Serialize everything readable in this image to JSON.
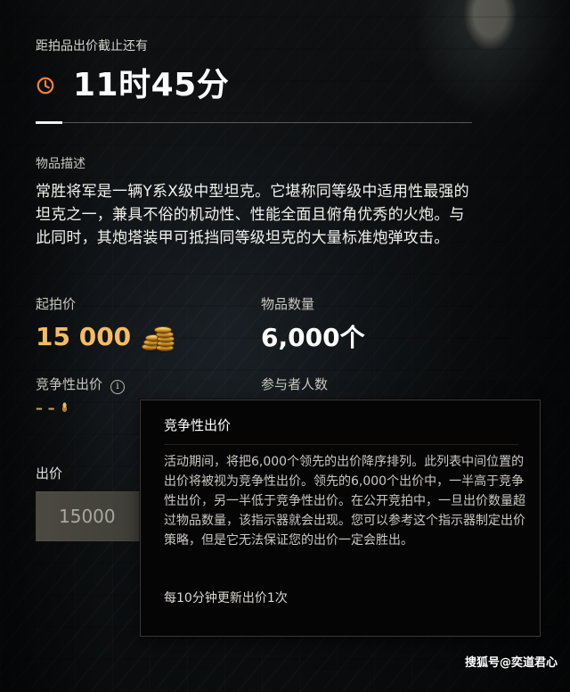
{
  "auction": {
    "deadline_label": "距拍品出价截止还有",
    "time_remaining": "11时45分",
    "description_label": "物品描述",
    "description": "常胜将军是一辆Y系X级中型坦克。它堪称同等级中适用性最强的坦克之一，兼具不俗的机动性、性能全面且俯角优秀的火炮。与此同时，其炮塔装甲可抵挡同等级坦克的大量标准炮弹攻击。",
    "starting_price_label": "起拍价",
    "starting_price": "15 000",
    "quantity_label": "物品数量",
    "quantity": "6,000个",
    "competitive_bid_label": "竞争性出价",
    "competitive_bid_value": "– –",
    "participants_label": "参与者人数",
    "bid_label": "出价",
    "bid_value": "15000"
  },
  "icons": {
    "clock": "clock-icon",
    "currency": "gold-coins-icon",
    "info": "info-icon",
    "accent_color": "#f58335",
    "gold_color": "#f5bd60"
  },
  "tooltip": {
    "title": "竞争性出价",
    "body": "活动期间，将把6,000个领先的出价降序排列。此列表中间位置的出价将被视为竞争性出价。领先的6,000个出价中，一半高于竞争性出价，另一半低于竞争性出价。在公开竞拍中，一旦出价数量超过物品数量，该指示器就会出现。您可以参考这个指示器制定出价策略，但是它无法保证您的出价一定会胜出。",
    "footer": "每10分钟更新出价1次"
  },
  "watermark": {
    "text": "搜狐号@奕道君心"
  }
}
